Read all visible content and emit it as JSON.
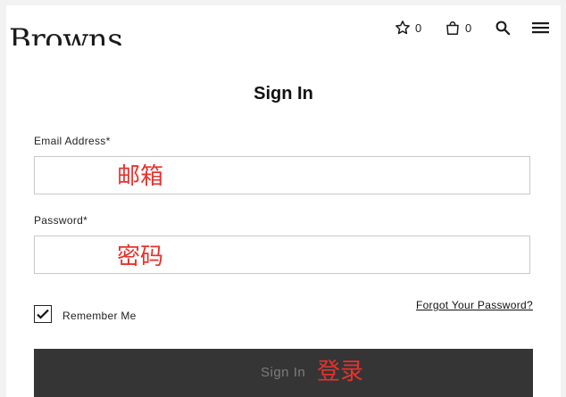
{
  "header": {
    "logo_text": "Browns",
    "wishlist_count": "0",
    "bag_count": "0",
    "icons": [
      "star-icon",
      "bag-icon",
      "search-icon",
      "menu-icon"
    ]
  },
  "form": {
    "title": "Sign In",
    "email_label": "Email Address*",
    "email_value": "",
    "password_label": "Password*",
    "password_value": "",
    "remember_label": "Remember Me",
    "remember_checked": true,
    "forgot_link": "Forgot Your Password?",
    "submit_label": "Sign In"
  },
  "annotations": {
    "email": "邮箱",
    "password": "密码",
    "signin": "登录",
    "color": "#e8322d"
  },
  "colors": {
    "button_bg": "#353535",
    "button_text": "#7d7d7d",
    "field_border": "#c9c9c9"
  }
}
